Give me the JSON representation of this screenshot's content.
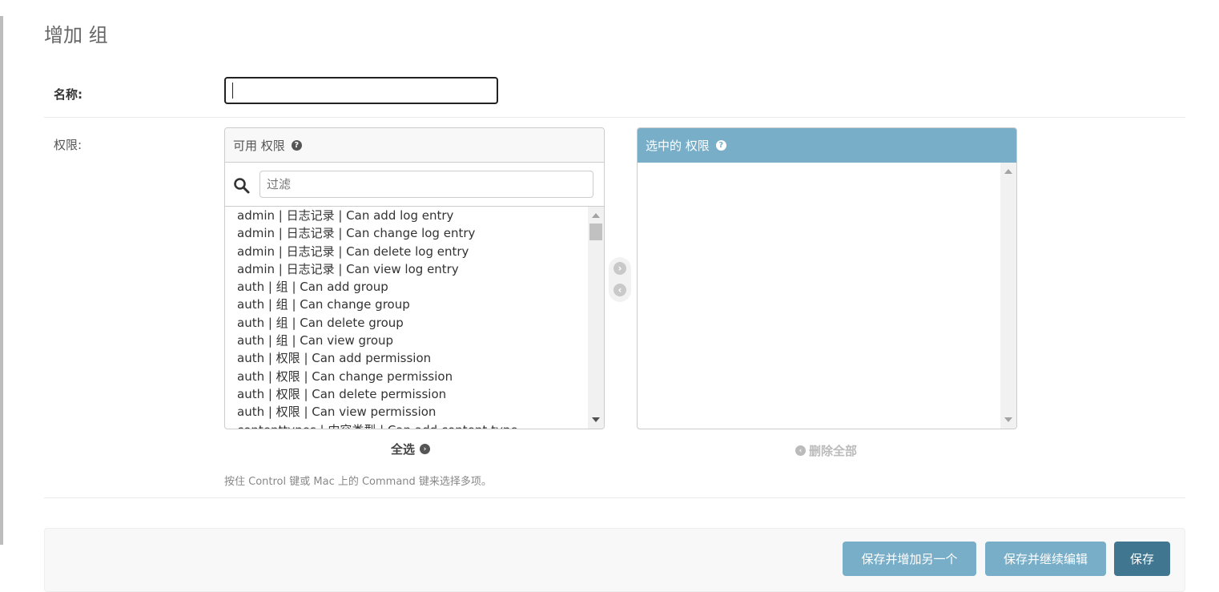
{
  "page": {
    "title": "增加 组"
  },
  "form": {
    "name_label": "名称:",
    "name_value": "",
    "permissions_label": "权限:"
  },
  "available": {
    "header": "可用 权限",
    "filter_placeholder": "过滤",
    "options": [
      "admin | 日志记录 | Can add log entry",
      "admin | 日志记录 | Can change log entry",
      "admin | 日志记录 | Can delete log entry",
      "admin | 日志记录 | Can view log entry",
      "auth | 组 | Can add group",
      "auth | 组 | Can change group",
      "auth | 组 | Can delete group",
      "auth | 组 | Can view group",
      "auth | 权限 | Can add permission",
      "auth | 权限 | Can change permission",
      "auth | 权限 | Can delete permission",
      "auth | 权限 | Can view permission",
      "contenttypes | 内容类型 | Can add content type"
    ],
    "choose_all": "全选"
  },
  "chosen": {
    "header": "选中的 权限",
    "remove_all": "删除全部"
  },
  "help_text": "按住 Control 键或 Mac 上的 Command 键来选择多项。",
  "buttons": {
    "save_add_another": "保存并增加另一个",
    "save_continue": "保存并继续编辑",
    "save": "保存"
  },
  "colors": {
    "accent": "#79aec8",
    "primary": "#417690"
  }
}
